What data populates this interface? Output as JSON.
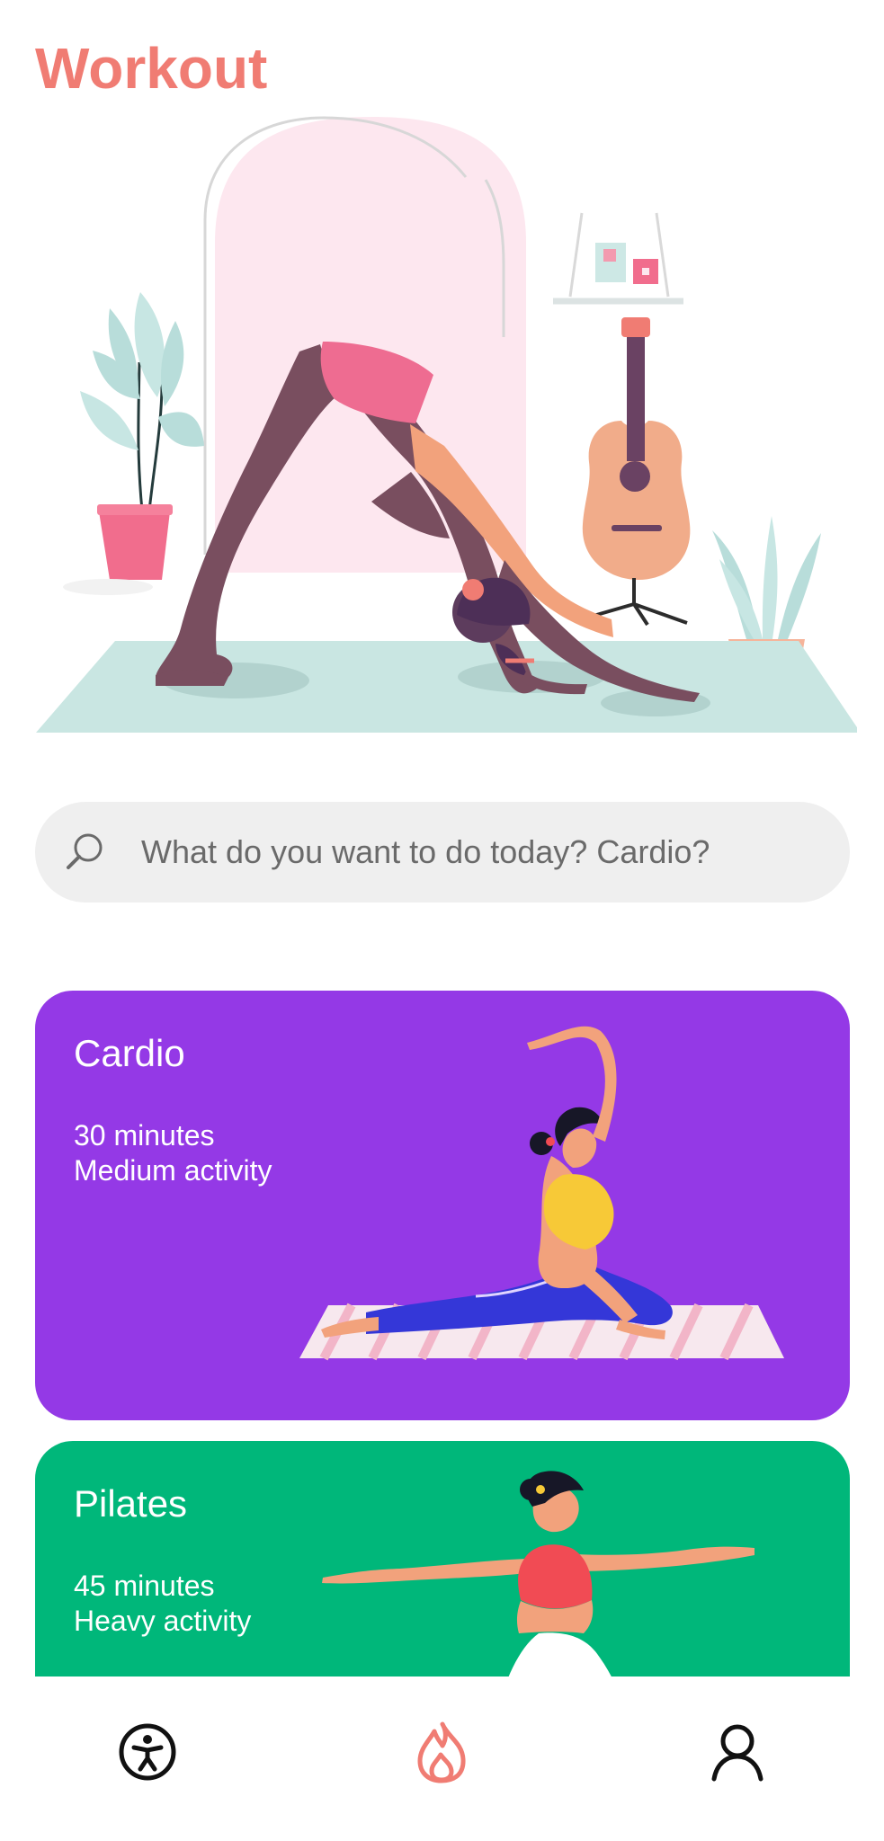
{
  "header": {
    "title": "Workout"
  },
  "colors": {
    "accent": "#F07C73",
    "cardio_card": "#9439E6",
    "pilates_card": "#00B77A",
    "search_background": "#EFEFEF",
    "nav_icon": "#111111",
    "nav_active_icon": "#F07C73",
    "mat": "#C9E6E2",
    "arch": "#FDE7EF"
  },
  "search": {
    "placeholder": "What do you want to do today? Cardio?",
    "value": "",
    "icon": "search-icon"
  },
  "hero": {
    "illustration": "yoga-downward-dog-illustration"
  },
  "cards": [
    {
      "id": "cardio",
      "title": "Cardio",
      "duration": "30 minutes",
      "activity": "Medium activity",
      "illustration": "seated-yoga-stretch-illustration"
    },
    {
      "id": "pilates",
      "title": "Pilates",
      "duration": "45 minutes",
      "activity": "Heavy activity",
      "illustration": "arms-extended-pose-illustration"
    }
  ],
  "bottom_nav": {
    "items": [
      {
        "name": "accessibility",
        "icon": "accessibility-icon",
        "active": false
      },
      {
        "name": "workout",
        "icon": "flame-icon",
        "active": true
      },
      {
        "name": "profile",
        "icon": "user-icon",
        "active": false
      }
    ]
  }
}
